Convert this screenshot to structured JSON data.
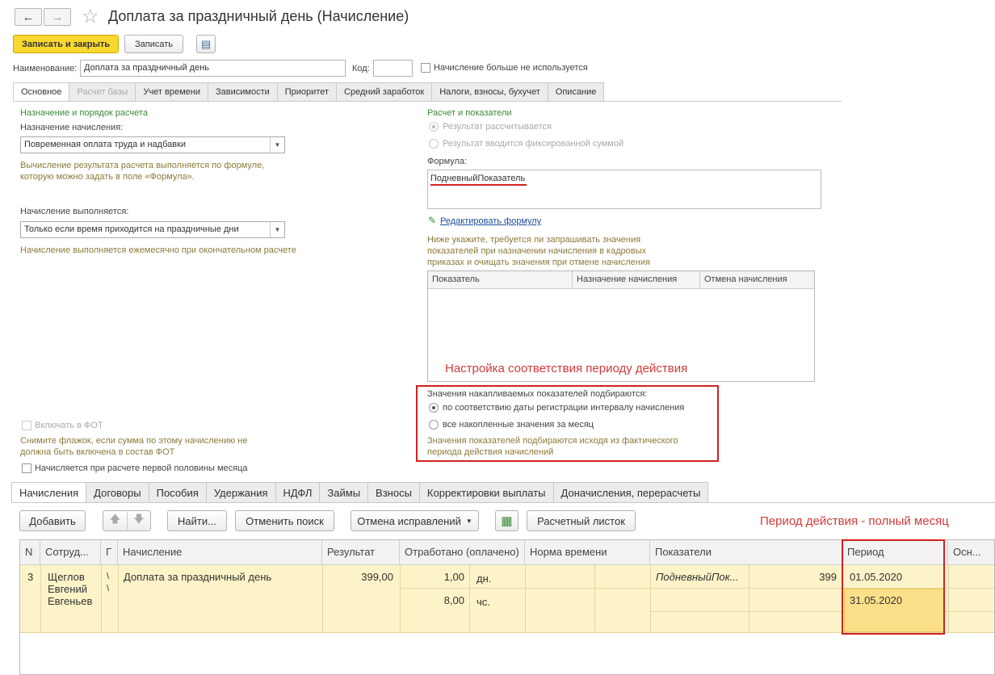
{
  "window": {
    "title": "Доплата за праздничный день (Начисление)",
    "back_icon": "←",
    "forward_icon": "→",
    "star_icon": "☆"
  },
  "toolbar": {
    "save_close": "Записать и закрыть",
    "save": "Записать",
    "report_icon": "▤"
  },
  "header": {
    "name_label": "Наименование:",
    "name_value": "Доплата за праздничный день",
    "code_label": "Код:",
    "code_value": "",
    "unused_label": "Начисление больше не используется"
  },
  "tabs_top": [
    "Основное",
    "Расчет базы",
    "Учет времени",
    "Зависимости",
    "Приоритет",
    "Средний заработок",
    "Налоги, взносы, бухучет",
    "Описание"
  ],
  "left": {
    "section_title": "Назначение и порядок расчета",
    "purpose_label": "Назначение начисления:",
    "purpose_value": "Повременная оплата труда и надбавки",
    "purpose_hint_1": "Вычисление результата расчета выполняется по формуле,",
    "purpose_hint_2": "которую можно задать в поле «Формула».",
    "exec_label": "Начисление выполняется:",
    "exec_value": "Только если время приходится на праздничные дни",
    "exec_hint": "Начисление выполняется ежемесячно при окончательном расчете",
    "fot_label": "Включать в ФОТ",
    "fot_hint_1": "Снимите флажок, если сумма по этому начислению не",
    "fot_hint_2": "должна быть включена в состав ФОТ",
    "half_label": "Начисляется при расчете первой половины месяца"
  },
  "right": {
    "section_title": "Расчет и показатели",
    "radio_calc": "Результат рассчитывается",
    "radio_fixed": "Результат вводится фиксированной суммой",
    "formula_label": "Формула:",
    "formula_value": "ПодневныйПоказатель",
    "edit_formula": "Редактировать формулу",
    "pencil_icon": "✎",
    "indicators_hint_1": "Ниже укажите, требуется ли запрашивать значения",
    "indicators_hint_2": "показателей при назначении начисления в кадровых",
    "indicators_hint_3": "приказах и очищать значения при отмене начисления",
    "grid_headers": [
      "Показатель",
      "Назначение начисления",
      "Отмена начисления"
    ],
    "accum_label": "Значения накапливаемых показателей подбираются:",
    "accum_opt1": "по соответствию даты регистрации интервалу начисления",
    "accum_opt2": "все накопленные значения за месяц",
    "accum_hint_1": "Значения показателей подбираются исходя из фактического",
    "accum_hint_2": "периода действия начислений"
  },
  "annotations": {
    "settings_note": "Настройка соответствия периоду действия",
    "period_note": "Период действия - полный месяц",
    "accent_color": "#d42020"
  },
  "tabs_bottom": [
    "Начисления",
    "Договоры",
    "Пособия",
    "Удержания",
    "НДФЛ",
    "Займы",
    "Взносы",
    "Корректировки выплаты",
    "Доначисления, перерасчеты"
  ],
  "bottom_toolbar": {
    "add": "Добавить",
    "up_icon": "🡅",
    "down_icon": "🡇",
    "find": "Найти...",
    "cancel_search": "Отменить поиск",
    "corrections": "Отмена исправлений",
    "table_icon": "▦",
    "payslip": "Расчетный листок"
  },
  "table": {
    "headers": [
      "N",
      "Сотруд...",
      "Г",
      "Начисление",
      "Результат",
      "Отработано (оплачено)",
      "Норма времени",
      "Показатели",
      "Период",
      "Осн..."
    ],
    "row": {
      "n": "3",
      "employee_1": "Щеглов",
      "employee_2": "Евгений",
      "employee_3": "Евгеньев",
      "g": "\\",
      "g2": "\\",
      "accrual": "Доплата за праздничный день",
      "result": "399,00",
      "worked_1": "1,00",
      "worked_unit_1": "дн.",
      "worked_2": "8,00",
      "worked_unit_2": "чс.",
      "indicator_name": "ПодневныйПок...",
      "indicator_value": "399",
      "period_start": "01.05.2020",
      "period_end": "31.05.2020"
    }
  }
}
